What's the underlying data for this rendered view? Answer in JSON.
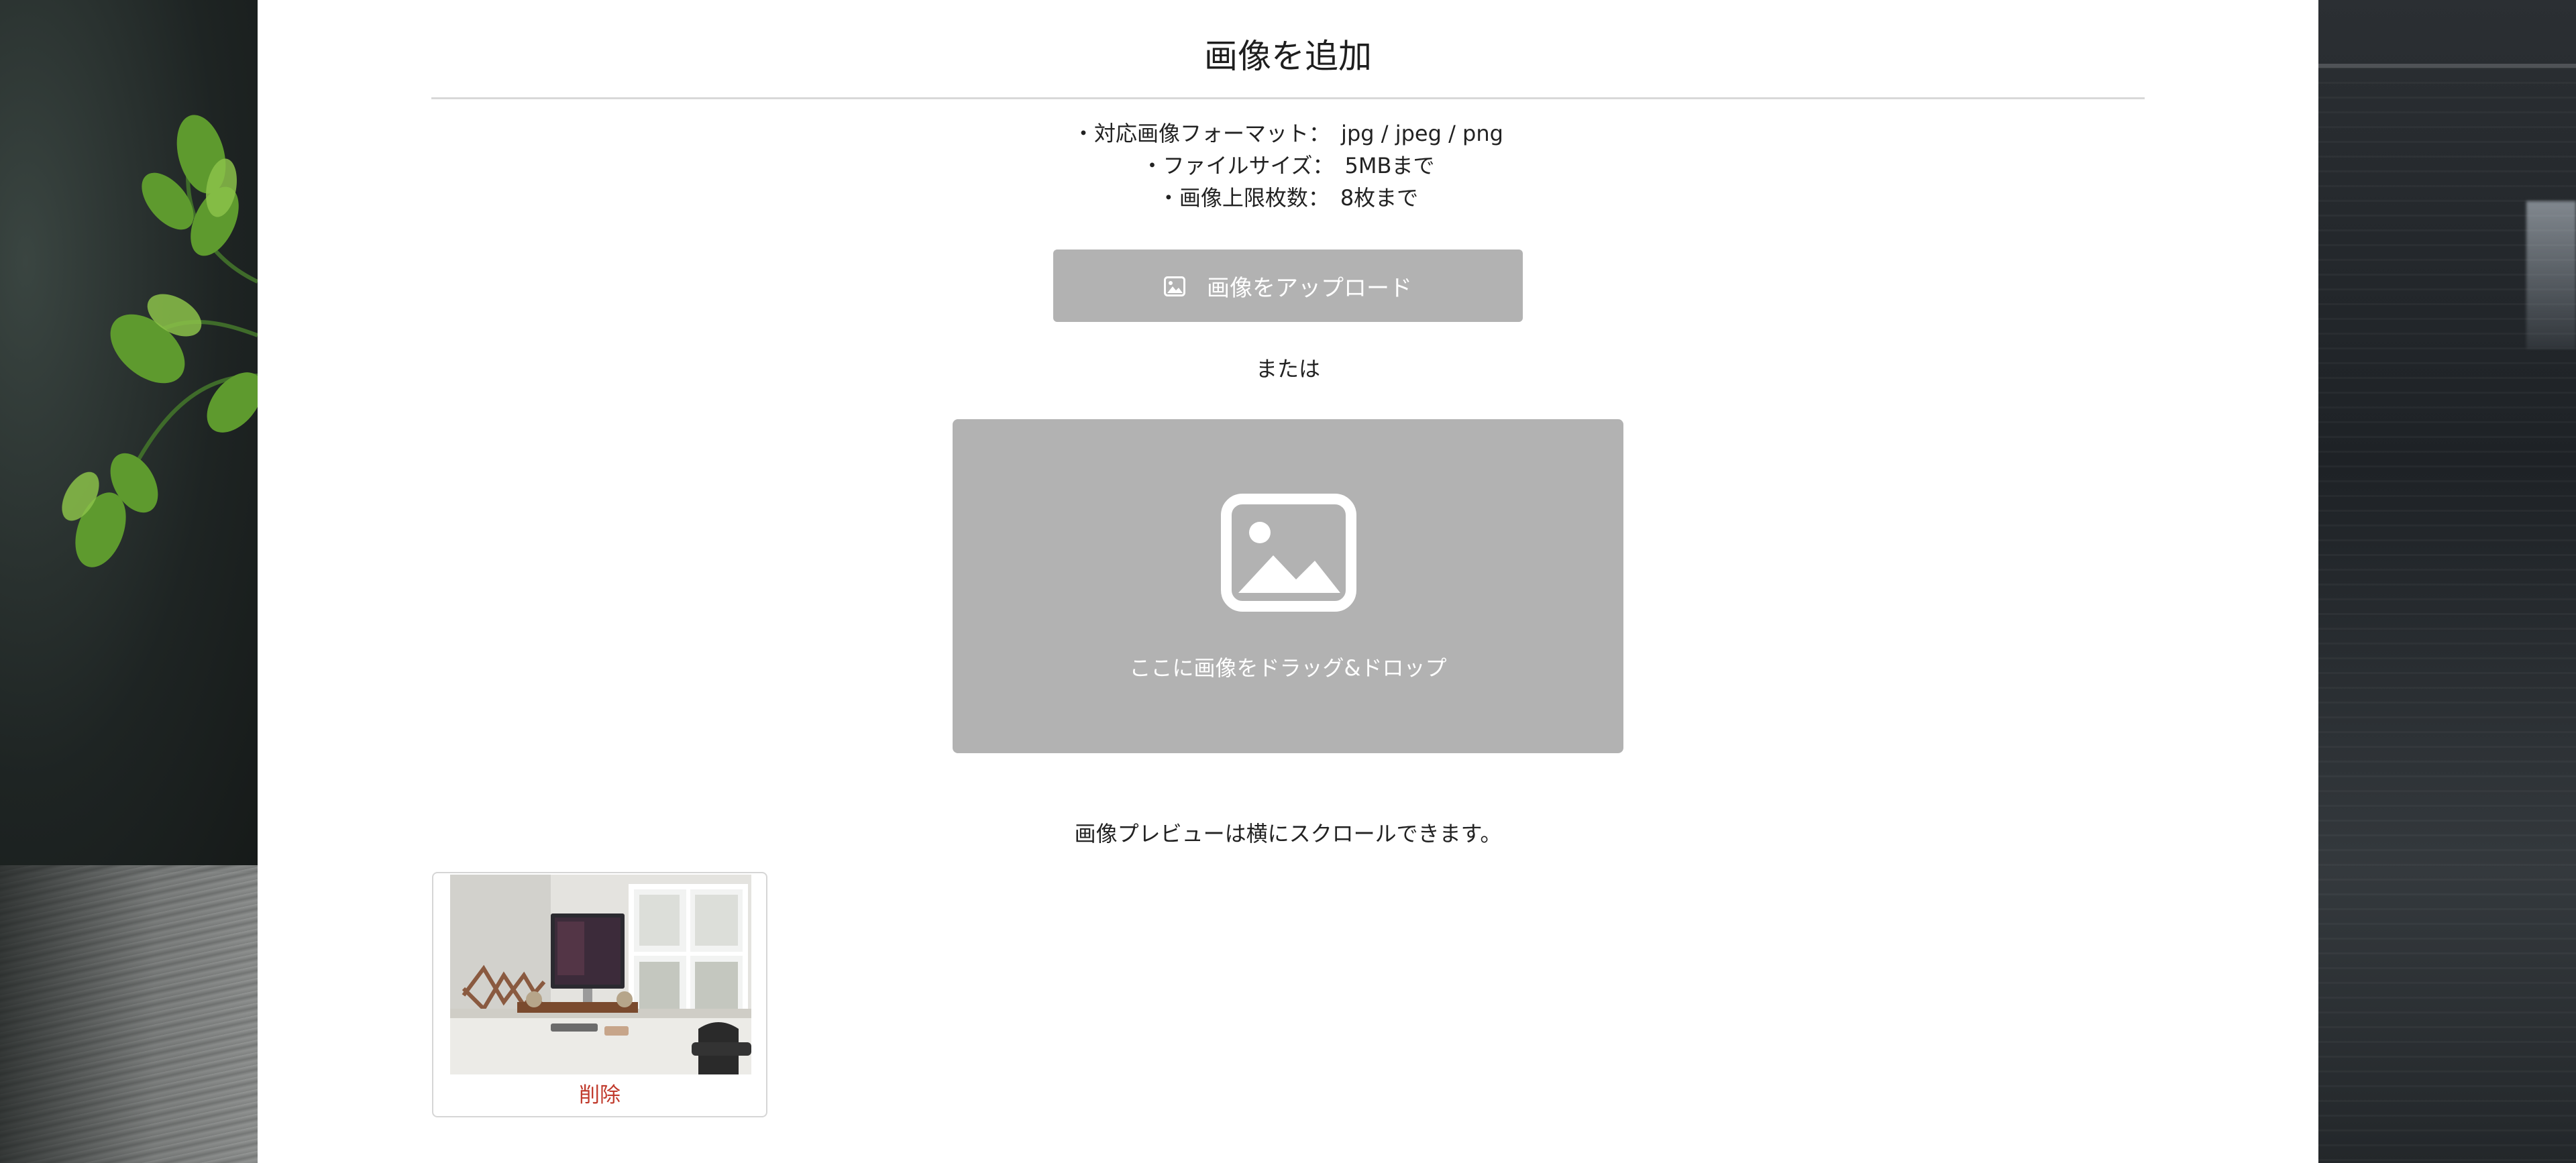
{
  "header": {
    "title": "画像を追加"
  },
  "rules": [
    "・対応画像フォーマット：　jpg / jpeg / png",
    "・ファイルサイズ：　5MBまで",
    "・画像上限枚数：　8枚まで"
  ],
  "upload": {
    "button_label": "画像をアップロード",
    "icon": "image-icon"
  },
  "separator": {
    "or_label": "または"
  },
  "dropzone": {
    "label": "ここに画像をドラッグ&ドロップ",
    "icon": "image-icon"
  },
  "preview": {
    "note": "画像プレビューは横にスクロールできます。",
    "items": [
      {
        "alt": "desk-workspace-photo",
        "delete_label": "削除"
      }
    ]
  },
  "colors": {
    "button_bg": "#b2b2b2",
    "dropzone_bg": "#b2b2b2",
    "delete": "#c0392b",
    "panel_bg": "#ffffff"
  }
}
